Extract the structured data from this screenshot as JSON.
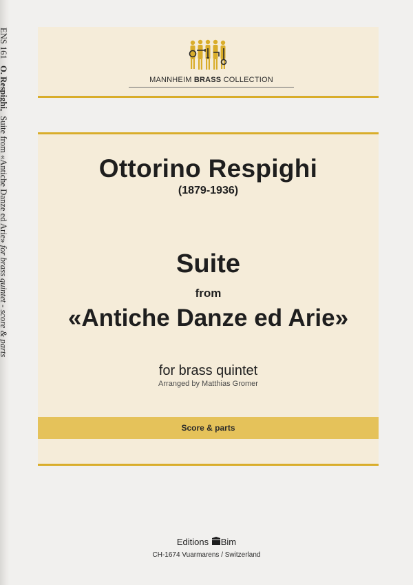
{
  "spine": {
    "code": "ENS 161",
    "author": "O. Respighi,",
    "title": "Suite from «Antiche Danze ed Arie»",
    "subtitle": "for brass quintet - score & parts"
  },
  "header": {
    "collection_pre": "MANNHEIM ",
    "collection_bold": "BRASS",
    "collection_post": " COLLECTION",
    "logo_icon": "brass-quintet-logo"
  },
  "composer": {
    "name": "Ottorino Respighi",
    "dates": "(1879-1936)"
  },
  "work": {
    "title": "Suite",
    "from": "from",
    "name": "«Antiche Danze ed Arie»",
    "instrumentation": "for brass quintet",
    "arranger": "Arranged by Matthias Gromer"
  },
  "edition": {
    "label": "Score & parts"
  },
  "publisher": {
    "name_pre": "Editions",
    "name_post": "Bim",
    "address": "CH-1674 Vuarmarens / Switzerland"
  },
  "colors": {
    "accent": "#d9ad2a",
    "band": "#e5c25a",
    "panel": "#f5ecd9"
  }
}
